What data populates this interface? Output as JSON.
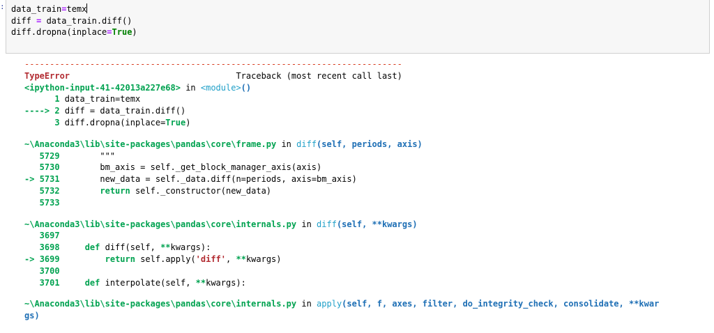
{
  "prompt_marker": ":",
  "input": {
    "line1_var": "data_train",
    "line1_op": "=",
    "line1_val": "temx",
    "line2_a": "diff ",
    "line2_op": "=",
    "line2_b": " data_train.diff()",
    "line3_a": "diff.dropna(inplace",
    "line3_op": "=",
    "line3_kw": "True",
    "line3_c": ")"
  },
  "traceback": {
    "dashes": "---------------------------------------------------------------------------",
    "error_type": "TypeError",
    "header_right": "                                 Traceback (most recent call last)",
    "input_ref": "<ipython-input-41-42013a227e68>",
    "in_word": " in ",
    "module": "<module>",
    "module_paren": "()",
    "f1": [
      {
        "num": "      1 ",
        "arrow": "",
        "code": "data_train=temx"
      },
      {
        "num": "2 ",
        "arrow": "----> ",
        "code": "diff = data_train.diff()"
      },
      {
        "num": "      3 ",
        "arrow": "",
        "code_a": "diff.dropna(inplace=",
        "code_kw": "True",
        "code_b": ")"
      }
    ],
    "frame2": {
      "path": "~\\Anaconda3\\lib\\site-packages\\pandas\\core\\frame.py",
      "in_word": " in ",
      "func": "diff",
      "args": "(self, periods, axis)",
      "l1_num": "   5729",
      "l1_code": "        \"\"\"",
      "l2_num": "   5730",
      "l2_code": "        bm_axis = self._get_block_manager_axis(axis)",
      "l3_arrow": "-> ",
      "l3_num": "5731",
      "l3_code": "        new_data = self._data.diff(n=periods, axis=bm_axis)",
      "l4_num": "   5732",
      "l4_kw": "        return",
      "l4_code": " self._constructor(new_data)",
      "l5_num": "   5733"
    },
    "frame3": {
      "path": "~\\Anaconda3\\lib\\site-packages\\pandas\\core\\internals.py",
      "in_word": " in ",
      "func": "diff",
      "args": "(self, **kwargs)",
      "l1_num": "   3697",
      "l2_num": "   3698",
      "l2_kw": "     def",
      "l2_code": " diff(self, ",
      "l2_op": "**",
      "l2_code2": "kwargs):",
      "l3_arrow": "-> ",
      "l3_num": "3699",
      "l3_kw": "         return",
      "l3_code": " self.apply(",
      "l3_str": "'diff'",
      "l3_code2": ", ",
      "l3_op": "**",
      "l3_code3": "kwargs)",
      "l4_num": "   3700",
      "l5_num": "   3701",
      "l5_kw": "     def",
      "l5_code": " interpolate(self, ",
      "l5_op": "**",
      "l5_code2": "kwargs):"
    },
    "frame4": {
      "path": "~\\Anaconda3\\lib\\site-packages\\pandas\\core\\internals.py",
      "in_word": " in ",
      "func": "apply",
      "args": "(self, f, axes, filter, do_integrity_check, consolidate, **kwar",
      "args_wrap": "gs)"
    }
  }
}
